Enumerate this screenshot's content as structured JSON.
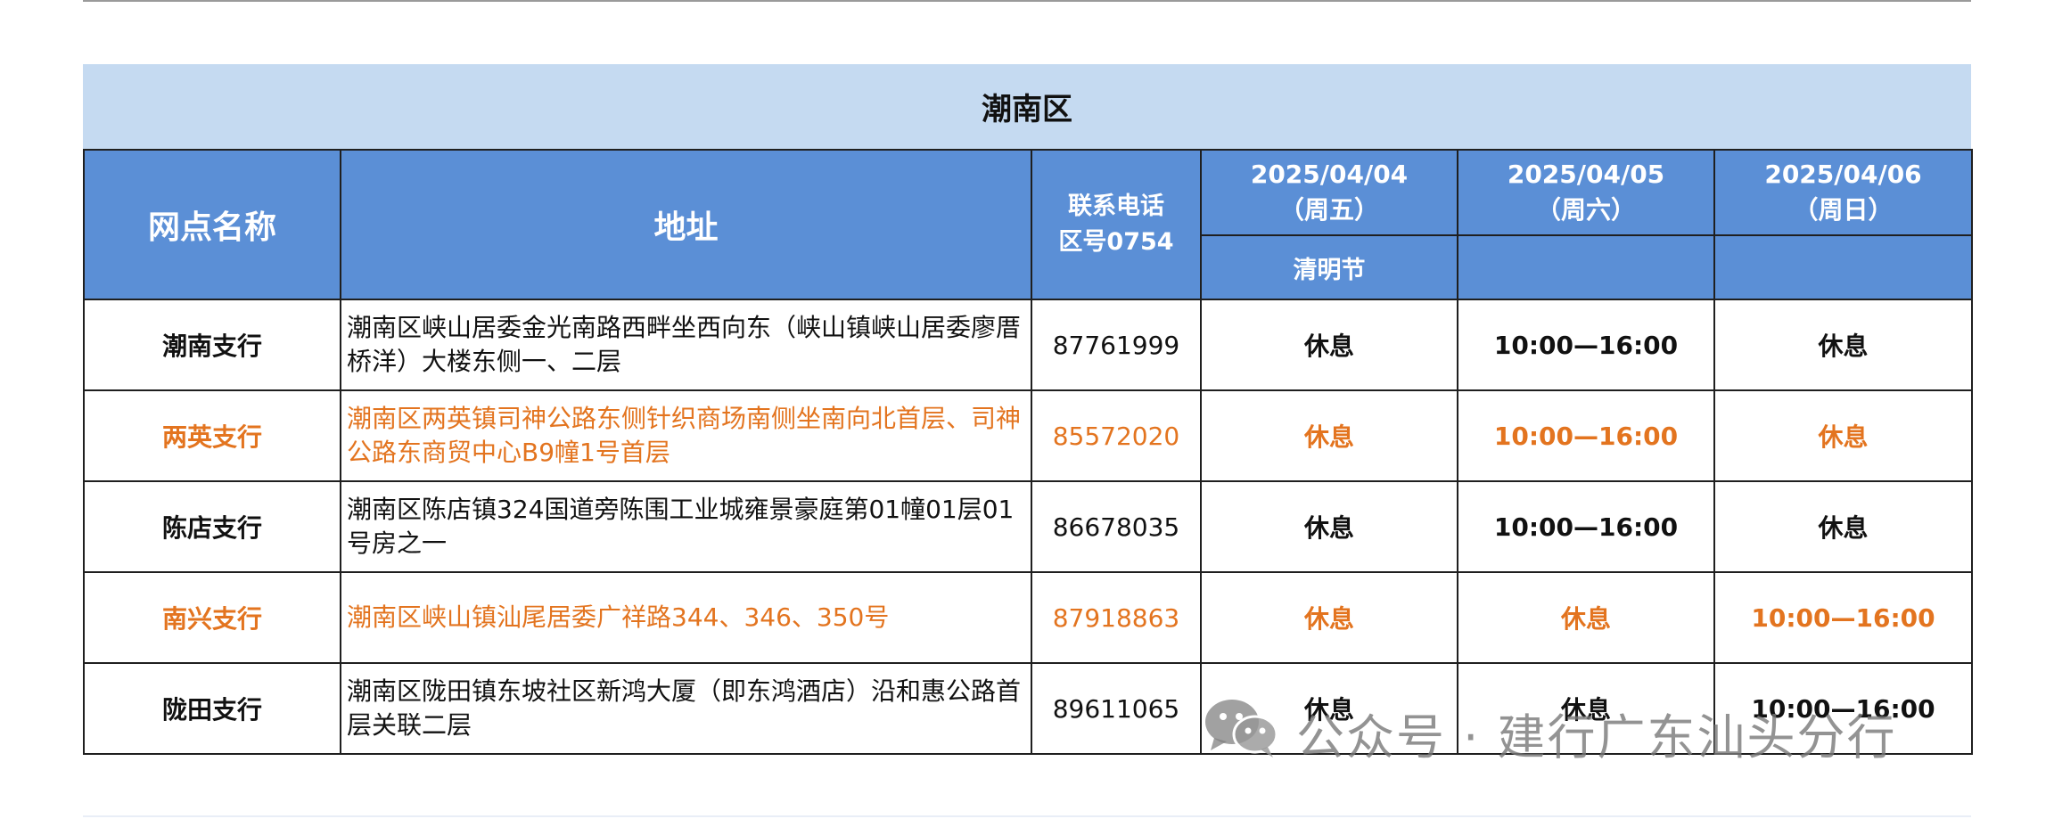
{
  "region": "潮南区",
  "columns": {
    "name": "网点名称",
    "address": "地址",
    "phone_line1": "联系电话",
    "phone_line2": "区号0754",
    "dates": [
      {
        "date": "2025/04/04",
        "weekday": "（周五）",
        "note": "清明节"
      },
      {
        "date": "2025/04/05",
        "weekday": "（周六）",
        "note": ""
      },
      {
        "date": "2025/04/06",
        "weekday": "（周日）",
        "note": ""
      }
    ]
  },
  "rows": [
    {
      "name": "潮南支行",
      "address": "潮南区峡山居委金光南路西畔坐西向东（峡山镇峡山居委廖厝桥洋）大楼东侧一、二层",
      "phone": "87761999",
      "days": [
        "休息",
        "10:00—16:00",
        "休息"
      ],
      "highlight": false
    },
    {
      "name": "两英支行",
      "address": "潮南区两英镇司神公路东侧针织商场南侧坐南向北首层、司神公路东商贸中心B9幢1号首层",
      "phone": "85572020",
      "days": [
        "休息",
        "10:00—16:00",
        "休息"
      ],
      "highlight": true
    },
    {
      "name": "陈店支行",
      "address": "潮南区陈店镇324国道旁陈围工业城雍景豪庭第01幢01层01号房之一",
      "phone": "86678035",
      "days": [
        "休息",
        "10:00—16:00",
        "休息"
      ],
      "highlight": false
    },
    {
      "name": "南兴支行",
      "address": "潮南区峡山镇汕尾居委广祥路344、346、350号",
      "phone": "87918863",
      "days": [
        "休息",
        "休息",
        "10:00—16:00"
      ],
      "highlight": true
    },
    {
      "name": "陇田支行",
      "address": "潮南区陇田镇东坡社区新鸿大厦（即东鸿酒店）沿和惠公路首层关联二层",
      "phone": "89611065",
      "days": [
        "休息",
        "休息",
        "10:00—16:00"
      ],
      "highlight": false
    }
  ],
  "watermark": "公众号 · 建行广东汕头分行",
  "colors": {
    "header_blue": "#5b8fd6",
    "region_band": "#c5daf1",
    "highlight_orange": "#e3741f"
  }
}
